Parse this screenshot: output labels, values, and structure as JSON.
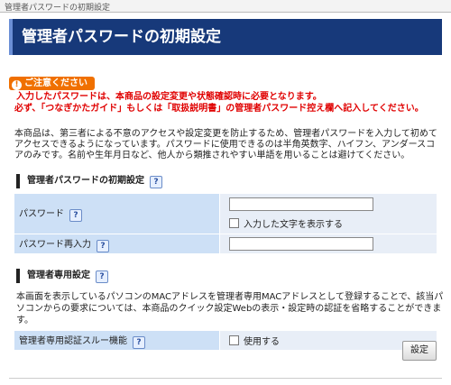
{
  "breadcrumb": "管理者パスワードの初期設定",
  "title": "管理者パスワードの初期設定",
  "caution": {
    "badge": "ご注意ください",
    "line1": "入力したパスワードは、本商品の設定変更や状態確認時に必要となります。",
    "line2": "必ず、「つなぎかたガイド」もしくは「取扱説明書」の管理者パスワード控え欄へ記入してください。"
  },
  "description": "本商品は、第三者による不意のアクセスや設定変更を防止するため、管理者パスワードを入力して初めてアクセスできるようになっています。パスワードに使用できるのは半角英数字、ハイフン、アンダースコアのみです。名前や生年月日など、他人から類推されやすい単語を用いることは避けてください。",
  "section_password": {
    "heading": "管理者パスワードの初期設定",
    "help": "?",
    "rows": [
      {
        "label": "パスワード",
        "value": "",
        "show_text_label": "入力した文字を表示する"
      },
      {
        "label": "パスワード再入力",
        "value": ""
      }
    ]
  },
  "section_mac": {
    "heading": "管理者専用設定",
    "help": "?",
    "description": "本画面を表示しているパソコンのMACアドレスを管理者専用MACアドレスとして登録することで、該当パソコンからの要求については、本商品のクイック設定Webの表示・設定時の認証を省略することができます。",
    "rows": [
      {
        "label": "管理者専用認証スルー機能",
        "checkbox_label": "使用する"
      }
    ]
  },
  "submit_label": "設定",
  "colors": {
    "banner": "#17397a",
    "warning": "#e00000",
    "badge": "#f07000",
    "label_bg": "#cde0f6"
  }
}
